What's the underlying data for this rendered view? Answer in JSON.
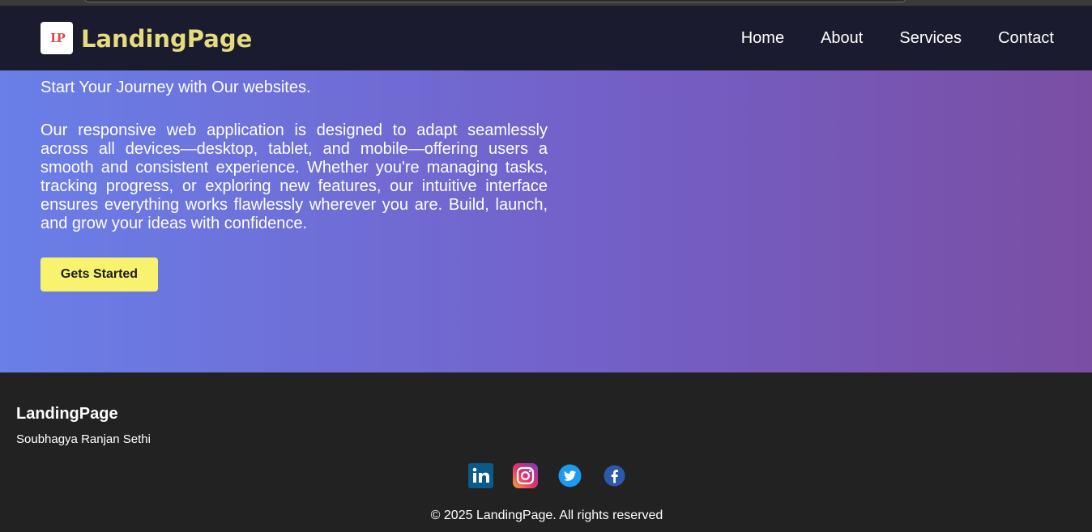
{
  "header": {
    "logo_text": "LP",
    "brand": "LandingPage",
    "nav": [
      "Home",
      "About",
      "Services",
      "Contact"
    ]
  },
  "hero": {
    "tagline": "Start Your Journey with Our websites.",
    "description": "Our responsive web application is designed to adapt seamlessly across all devices—desktop, tablet, and mobile—offering users a smooth and consistent experience. Whether you're managing tasks, tracking progress, or exploring new features, our intuitive interface ensures everything works flawlessly wherever you are. Build, launch, and grow your ideas with confidence.",
    "cta_label": "Gets Started"
  },
  "footer": {
    "brand": "LandingPage",
    "author": "Soubhagya Ranjan Sethi",
    "socials": [
      "linkedin-icon",
      "instagram-icon",
      "twitter-icon",
      "facebook-icon"
    ],
    "copyright": "© 2025 LandingPage. All rights reserved"
  },
  "colors": {
    "navbar_bg": "#1b1b2f",
    "brand_text": "#e4dc7e",
    "hero_gradient_start": "#6a7fe8",
    "hero_gradient_end": "#7a4ea3",
    "cta_bg": "#f7f36e",
    "footer_bg": "#222222"
  }
}
